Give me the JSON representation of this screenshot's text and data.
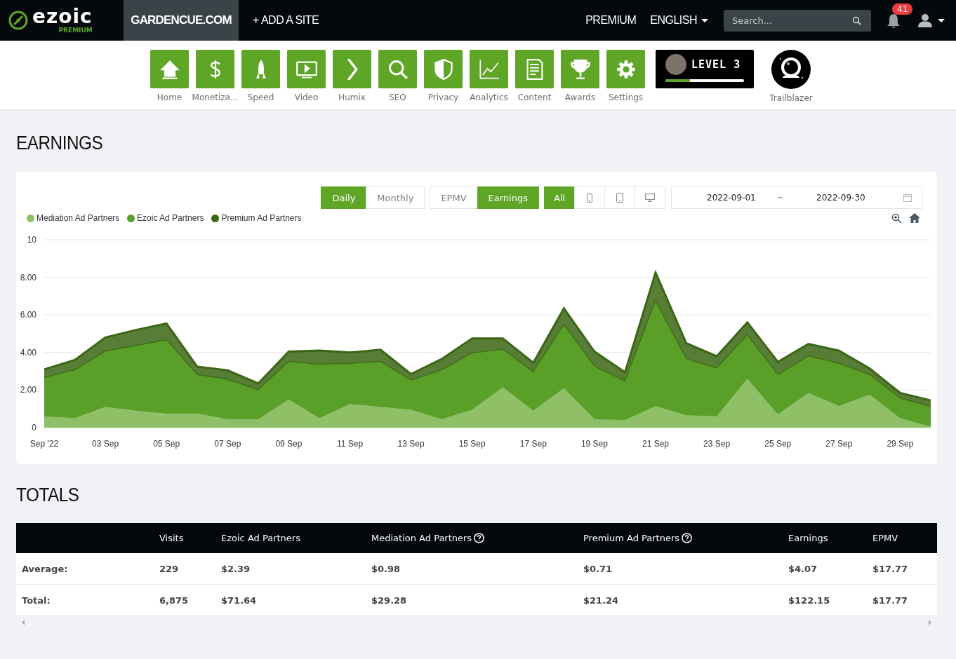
{
  "top_bar": {
    "logo": {
      "name": "ezoic",
      "tag": "PREMIUM"
    },
    "site": "GARDENCUE.COM",
    "add_site": "+ ADD A SITE",
    "premium": "PREMIUM",
    "language": "ENGLISH",
    "search": {
      "placeholder": "Search..."
    },
    "notifications": "41"
  },
  "nav_items": [
    {
      "label": "Home"
    },
    {
      "label": "Monetiza..."
    },
    {
      "label": "Speed"
    },
    {
      "label": "Video"
    },
    {
      "label": "Humix"
    },
    {
      "label": "SEO"
    },
    {
      "label": "Privacy"
    },
    {
      "label": "Analytics"
    },
    {
      "label": "Content"
    },
    {
      "label": "Awards"
    },
    {
      "label": "Settings"
    }
  ],
  "level_card": {
    "label": "LEVEL 3",
    "level": 0.31
  },
  "badge": {
    "label": "Trailblazer"
  },
  "earnings": {
    "title": "EARNINGS",
    "period_tabs": [
      {
        "label": "Daily",
        "selected": true
      },
      {
        "label": "Monthly",
        "selected": false
      }
    ],
    "metric_tabs": [
      {
        "label": "EPMV",
        "selected": false
      },
      {
        "label": "Earnings",
        "selected": true
      }
    ],
    "device_tabs": [
      {
        "kind": "text",
        "label": "All",
        "selected": true
      },
      {
        "kind": "phone",
        "selected": false
      },
      {
        "kind": "tablet",
        "selected": false
      },
      {
        "kind": "desktop",
        "selected": false
      }
    ],
    "date_range": {
      "start": "2022-09-01",
      "separator": "~",
      "end": "2022-09-30"
    },
    "chart_data": {
      "type": "area",
      "stacked": true,
      "grid": true,
      "categories": [
        "Sep '22",
        null,
        "03 Sep",
        null,
        "05 Sep",
        null,
        "07 Sep",
        null,
        "09 Sep",
        null,
        "11 Sep",
        null,
        "13 Sep",
        null,
        "15 Sep",
        null,
        "17 Sep",
        null,
        "19 Sep",
        null,
        "21 Sep",
        null,
        "23 Sep",
        null,
        "25 Sep",
        null,
        "27 Sep",
        null,
        "29 Sep",
        null
      ],
      "ylim": [
        0,
        10
      ],
      "yticks": [
        {
          "value": 0,
          "label": "0"
        },
        {
          "value": 2,
          "label": "2.00"
        },
        {
          "value": 4,
          "label": "4.00"
        },
        {
          "value": 6,
          "label": "6.00"
        },
        {
          "value": 8,
          "label": "8.00"
        },
        {
          "value": 10,
          "label": "10"
        }
      ],
      "series": [
        {
          "name": "Mediation Ad Partners",
          "color": "#8fc068",
          "values": [
            0.6,
            0.5,
            1.1,
            0.9,
            0.75,
            0.75,
            0.45,
            0.45,
            1.5,
            0.5,
            1.25,
            1.1,
            0.95,
            0.45,
            0.95,
            2.15,
            0.9,
            2.1,
            0.45,
            0.4,
            1.15,
            0.65,
            0.6,
            2.6,
            0.7,
            1.85,
            1.15,
            1.75,
            0.5,
            0.05
          ]
        },
        {
          "name": "Ezoic Ad Partners",
          "color": "#5a9f27",
          "values": [
            2.05,
            2.55,
            2.95,
            3.45,
            3.9,
            2.05,
            2.1,
            1.55,
            2.0,
            2.85,
            2.15,
            2.4,
            1.55,
            2.6,
            3.0,
            2.0,
            2.05,
            3.35,
            2.8,
            2.05,
            5.55,
            3.0,
            2.55,
            2.3,
            2.1,
            1.95,
            2.25,
            1.05,
            1.05,
            1.05
          ]
        },
        {
          "name": "Premium Ad Partners",
          "color": "#3b6614",
          "values": [
            0.45,
            0.55,
            0.75,
            0.85,
            0.9,
            0.45,
            0.5,
            0.35,
            0.55,
            0.75,
            0.6,
            0.65,
            0.35,
            0.6,
            0.8,
            0.6,
            0.5,
            0.9,
            0.8,
            0.5,
            1.55,
            0.85,
            0.65,
            0.7,
            0.7,
            0.65,
            0.7,
            0.35,
            0.3,
            0.35
          ]
        }
      ]
    }
  },
  "totals": {
    "title": "TOTALS",
    "columns": [
      {},
      {
        "label": "Visits"
      },
      {
        "label": "Ezoic Ad Partners"
      },
      {
        "label": "Mediation Ad Partners",
        "help": true
      },
      {
        "label": "Premium Ad Partners",
        "help": true
      },
      {
        "label": "Earnings"
      },
      {
        "label": "EPMV"
      }
    ],
    "rows": [
      [
        "Average:",
        "229",
        "$2.39",
        "$0.98",
        "$0.71",
        "$4.07",
        "$17.77"
      ],
      [
        "Total:",
        "6,875",
        "$71.64",
        "$29.28",
        "$21.24",
        "$122.15",
        "$17.77"
      ]
    ]
  }
}
